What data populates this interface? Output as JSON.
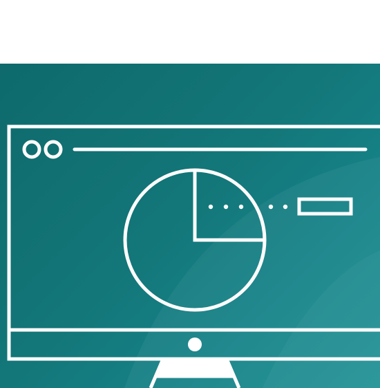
{
  "illustration": {
    "subject": "monitor-with-pie-chart-icon",
    "colors": {
      "background_top": "#ffffff",
      "panel_dark": "#0e6a6c",
      "panel_light": "#1a8f92",
      "line": "#ffffff"
    }
  }
}
